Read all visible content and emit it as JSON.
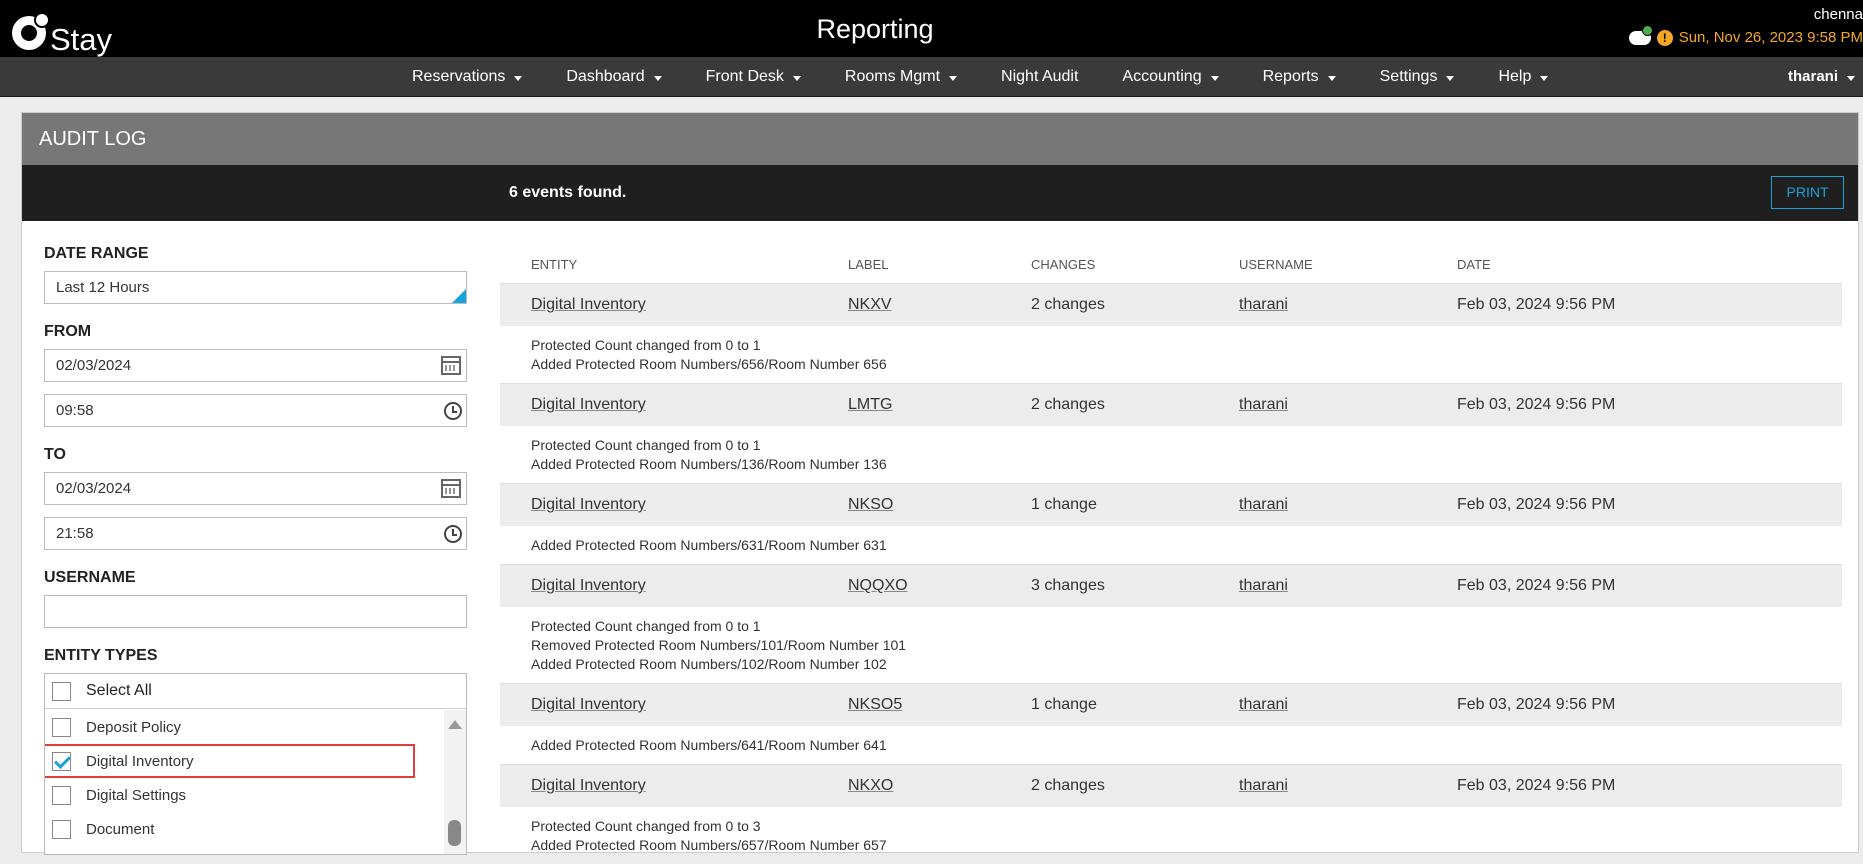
{
  "app": {
    "logo_text": "Stay",
    "page_title": "Reporting",
    "property_name": "chenna",
    "datetime": "Sun, Nov 26, 2023 9:58 PM",
    "accent_color": "#1aa3d9",
    "warning_color": "#f5a623"
  },
  "nav": {
    "items": [
      {
        "label": "Reservations",
        "dropdown": true
      },
      {
        "label": "Dashboard",
        "dropdown": true
      },
      {
        "label": "Front Desk",
        "dropdown": true
      },
      {
        "label": "Rooms Mgmt",
        "dropdown": true
      },
      {
        "label": "Night Audit",
        "dropdown": false
      },
      {
        "label": "Accounting",
        "dropdown": true
      },
      {
        "label": "Reports",
        "dropdown": true
      },
      {
        "label": "Settings",
        "dropdown": true
      },
      {
        "label": "Help",
        "dropdown": true
      }
    ],
    "user": "tharani"
  },
  "panel": {
    "title": "AUDIT LOG",
    "events_found": "6 events found.",
    "print_label": "PRINT"
  },
  "filters": {
    "date_range_label": "DATE RANGE",
    "date_range_value": "Last 12 Hours",
    "from_label": "FROM",
    "from_date": "02/03/2024",
    "from_time": "09:58",
    "to_label": "TO",
    "to_date": "02/03/2024",
    "to_time": "21:58",
    "username_label": "USERNAME",
    "username_value": "",
    "entity_types_label": "ENTITY TYPES",
    "select_all_label": "Select All",
    "entity_types": [
      {
        "label": "Deposit Policy",
        "checked": false
      },
      {
        "label": "Digital Inventory",
        "checked": true
      },
      {
        "label": "Digital Settings",
        "checked": false
      },
      {
        "label": "Document",
        "checked": false
      }
    ]
  },
  "results": {
    "headers": {
      "entity": "ENTITY",
      "label": "LABEL",
      "changes": "CHANGES",
      "username": "USERNAME",
      "date": "DATE"
    },
    "rows": [
      {
        "entity": "Digital Inventory",
        "label": "NKXV",
        "changes": "2 changes",
        "username": "tharani",
        "date": "Feb 03, 2024 9:56 PM",
        "details": [
          "Protected Count changed from 0 to 1",
          "Added Protected Room Numbers/656/Room Number 656"
        ]
      },
      {
        "entity": "Digital Inventory",
        "label": "LMTG",
        "changes": "2 changes",
        "username": "tharani",
        "date": "Feb 03, 2024 9:56 PM",
        "details": [
          "Protected Count changed from 0 to 1",
          "Added Protected Room Numbers/136/Room Number 136"
        ]
      },
      {
        "entity": "Digital Inventory",
        "label": "NKSO",
        "changes": "1 change",
        "username": "tharani",
        "date": "Feb 03, 2024 9:56 PM",
        "details": [
          "Added Protected Room Numbers/631/Room Number 631"
        ]
      },
      {
        "entity": "Digital Inventory",
        "label": "NQQXO",
        "changes": "3 changes",
        "username": "tharani",
        "date": "Feb 03, 2024 9:56 PM",
        "details": [
          "Protected Count changed from 0 to 1",
          "Removed Protected Room Numbers/101/Room Number 101",
          "Added Protected Room Numbers/102/Room Number 102"
        ]
      },
      {
        "entity": "Digital Inventory",
        "label": "NKSO5",
        "changes": "1 change",
        "username": "tharani",
        "date": "Feb 03, 2024 9:56 PM",
        "details": [
          "Added Protected Room Numbers/641/Room Number 641"
        ]
      },
      {
        "entity": "Digital Inventory",
        "label": "NKXO",
        "changes": "2 changes",
        "username": "tharani",
        "date": "Feb 03, 2024 9:56 PM",
        "details": [
          "Protected Count changed from 0 to 3",
          "Added Protected Room Numbers/657/Room Number 657"
        ]
      }
    ]
  }
}
